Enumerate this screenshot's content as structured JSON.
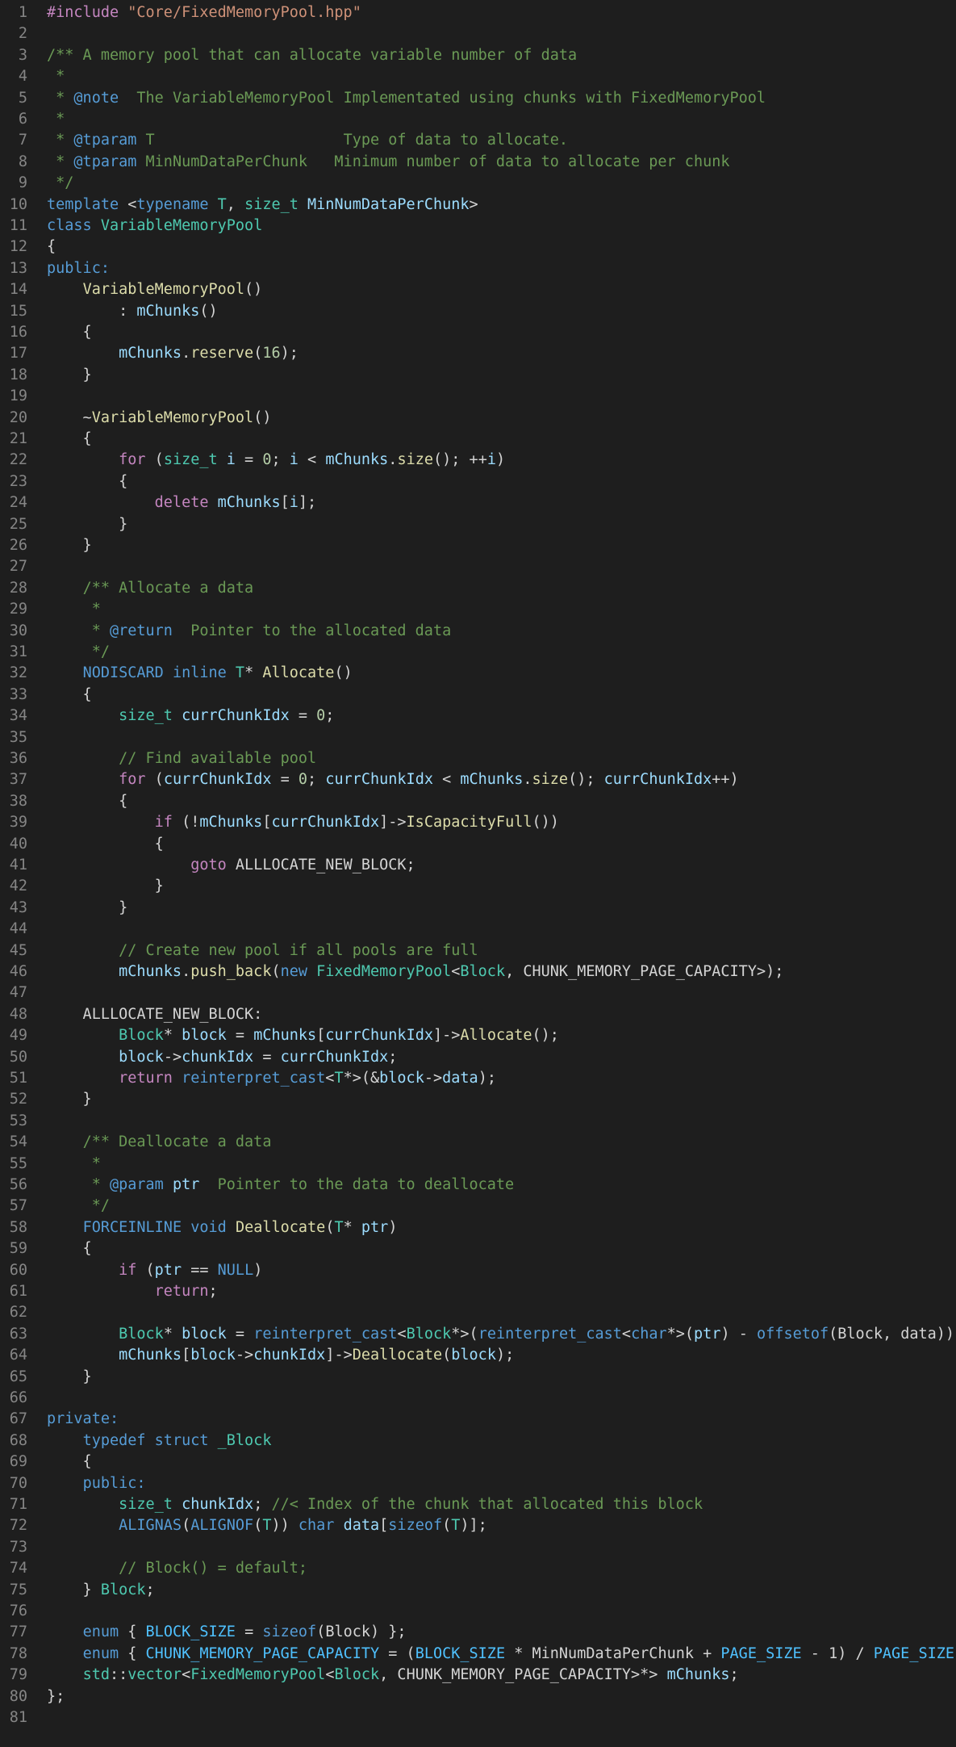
{
  "editor": {
    "language": "cpp",
    "colors": {
      "background": "#1e1e1e",
      "line_number": "#858585",
      "plain": "#d4d4d4",
      "comment": "#6a9955",
      "keyword": "#569cd6",
      "control": "#c586c0",
      "type": "#4ec9b0",
      "function": "#dcdcaa",
      "variable": "#9cdcfe",
      "number": "#b5cea8",
      "string": "#ce9178"
    },
    "lines": [
      [
        [
          "pp",
          "#include"
        ],
        [
          "pl",
          " "
        ],
        [
          "str",
          "\"Core/FixedMemoryPool.hpp\""
        ]
      ],
      [],
      [
        [
          "cm",
          "/** A memory pool that can allocate variable number of data"
        ]
      ],
      [
        [
          "cm",
          " *"
        ]
      ],
      [
        [
          "cm",
          " * "
        ],
        [
          "tag",
          "@note"
        ],
        [
          "cm",
          "  The VariableMemoryPool Implementated using chunks with FixedMemoryPool"
        ]
      ],
      [
        [
          "cm",
          " *"
        ]
      ],
      [
        [
          "cm",
          " * "
        ],
        [
          "tag",
          "@tparam"
        ],
        [
          "cm",
          " T                     Type of data to allocate."
        ]
      ],
      [
        [
          "cm",
          " * "
        ],
        [
          "tag",
          "@tparam"
        ],
        [
          "cm",
          " MinNumDataPerChunk   Minimum number of data to allocate per chunk"
        ]
      ],
      [
        [
          "cm",
          " */"
        ]
      ],
      [
        [
          "kw",
          "template"
        ],
        [
          "pl",
          " <"
        ],
        [
          "kw",
          "typename"
        ],
        [
          "pl",
          " "
        ],
        [
          "type",
          "T"
        ],
        [
          "pl",
          ", "
        ],
        [
          "type",
          "size_t"
        ],
        [
          "pl",
          " "
        ],
        [
          "var",
          "MinNumDataPerChunk"
        ],
        [
          "pl",
          ">"
        ]
      ],
      [
        [
          "kw",
          "class"
        ],
        [
          "pl",
          " "
        ],
        [
          "type",
          "VariableMemoryPool"
        ]
      ],
      [
        [
          "pl",
          "{"
        ]
      ],
      [
        [
          "kw",
          "public:"
        ]
      ],
      [
        [
          "pl",
          "    "
        ],
        [
          "fn",
          "VariableMemoryPool"
        ],
        [
          "pl",
          "()"
        ]
      ],
      [
        [
          "pl",
          "        : "
        ],
        [
          "var",
          "mChunks"
        ],
        [
          "pl",
          "()"
        ]
      ],
      [
        [
          "pl",
          "    {"
        ]
      ],
      [
        [
          "pl",
          "        "
        ],
        [
          "var",
          "mChunks"
        ],
        [
          "pl",
          "."
        ],
        [
          "fn",
          "reserve"
        ],
        [
          "pl",
          "("
        ],
        [
          "num",
          "16"
        ],
        [
          "pl",
          ");"
        ]
      ],
      [
        [
          "pl",
          "    }"
        ]
      ],
      [],
      [
        [
          "pl",
          "    ~"
        ],
        [
          "fn",
          "VariableMemoryPool"
        ],
        [
          "pl",
          "()"
        ]
      ],
      [
        [
          "pl",
          "    {"
        ]
      ],
      [
        [
          "pl",
          "        "
        ],
        [
          "ctl",
          "for"
        ],
        [
          "pl",
          " ("
        ],
        [
          "type",
          "size_t"
        ],
        [
          "pl",
          " "
        ],
        [
          "var",
          "i"
        ],
        [
          "pl",
          " = "
        ],
        [
          "num",
          "0"
        ],
        [
          "pl",
          "; "
        ],
        [
          "var",
          "i"
        ],
        [
          "pl",
          " < "
        ],
        [
          "var",
          "mChunks"
        ],
        [
          "pl",
          "."
        ],
        [
          "fn",
          "size"
        ],
        [
          "pl",
          "(); ++"
        ],
        [
          "var",
          "i"
        ],
        [
          "pl",
          ")"
        ]
      ],
      [
        [
          "pl",
          "        {"
        ]
      ],
      [
        [
          "pl",
          "            "
        ],
        [
          "ctl",
          "delete"
        ],
        [
          "pl",
          " "
        ],
        [
          "var",
          "mChunks"
        ],
        [
          "pl",
          "["
        ],
        [
          "var",
          "i"
        ],
        [
          "pl",
          "];"
        ]
      ],
      [
        [
          "pl",
          "        }"
        ]
      ],
      [
        [
          "pl",
          "    }"
        ]
      ],
      [],
      [
        [
          "pl",
          "    "
        ],
        [
          "cm",
          "/** Allocate a data"
        ]
      ],
      [
        [
          "cm",
          "     *"
        ]
      ],
      [
        [
          "cm",
          "     * "
        ],
        [
          "tag",
          "@return"
        ],
        [
          "cm",
          "  Pointer to the allocated data"
        ]
      ],
      [
        [
          "cm",
          "     */"
        ]
      ],
      [
        [
          "pl",
          "    "
        ],
        [
          "mac",
          "NODISCARD"
        ],
        [
          "pl",
          " "
        ],
        [
          "kw",
          "inline"
        ],
        [
          "pl",
          " "
        ],
        [
          "type",
          "T"
        ],
        [
          "pl",
          "* "
        ],
        [
          "fn",
          "Allocate"
        ],
        [
          "pl",
          "()"
        ]
      ],
      [
        [
          "pl",
          "    {"
        ]
      ],
      [
        [
          "pl",
          "        "
        ],
        [
          "type",
          "size_t"
        ],
        [
          "pl",
          " "
        ],
        [
          "var",
          "currChunkIdx"
        ],
        [
          "pl",
          " = "
        ],
        [
          "num",
          "0"
        ],
        [
          "pl",
          ";"
        ]
      ],
      [],
      [
        [
          "pl",
          "        "
        ],
        [
          "cm",
          "// Find available pool"
        ]
      ],
      [
        [
          "pl",
          "        "
        ],
        [
          "ctl",
          "for"
        ],
        [
          "pl",
          " ("
        ],
        [
          "var",
          "currChunkIdx"
        ],
        [
          "pl",
          " = "
        ],
        [
          "num",
          "0"
        ],
        [
          "pl",
          "; "
        ],
        [
          "var",
          "currChunkIdx"
        ],
        [
          "pl",
          " < "
        ],
        [
          "var",
          "mChunks"
        ],
        [
          "pl",
          "."
        ],
        [
          "fn",
          "size"
        ],
        [
          "pl",
          "(); "
        ],
        [
          "var",
          "currChunkIdx"
        ],
        [
          "pl",
          "++)"
        ]
      ],
      [
        [
          "pl",
          "        {"
        ]
      ],
      [
        [
          "pl",
          "            "
        ],
        [
          "ctl",
          "if"
        ],
        [
          "pl",
          " (!"
        ],
        [
          "var",
          "mChunks"
        ],
        [
          "pl",
          "["
        ],
        [
          "var",
          "currChunkIdx"
        ],
        [
          "pl",
          "]->"
        ],
        [
          "fn",
          "IsCapacityFull"
        ],
        [
          "pl",
          "())"
        ]
      ],
      [
        [
          "pl",
          "            {"
        ]
      ],
      [
        [
          "pl",
          "                "
        ],
        [
          "ctl",
          "goto"
        ],
        [
          "pl",
          " ALLLOCATE_NEW_BLOCK;"
        ]
      ],
      [
        [
          "pl",
          "            }"
        ]
      ],
      [
        [
          "pl",
          "        }"
        ]
      ],
      [],
      [
        [
          "pl",
          "        "
        ],
        [
          "cm",
          "// Create new pool if all pools are full"
        ]
      ],
      [
        [
          "pl",
          "        "
        ],
        [
          "var",
          "mChunks"
        ],
        [
          "pl",
          "."
        ],
        [
          "fn",
          "push_back"
        ],
        [
          "pl",
          "("
        ],
        [
          "kw",
          "new"
        ],
        [
          "pl",
          " "
        ],
        [
          "type",
          "FixedMemoryPool"
        ],
        [
          "pl",
          "<"
        ],
        [
          "type",
          "Block"
        ],
        [
          "pl",
          ", CHUNK_MEMORY_PAGE_CAPACITY>);"
        ]
      ],
      [],
      [
        [
          "pl",
          "    ALLLOCATE_NEW_BLOCK:"
        ]
      ],
      [
        [
          "pl",
          "        "
        ],
        [
          "type",
          "Block"
        ],
        [
          "pl",
          "* "
        ],
        [
          "var",
          "block"
        ],
        [
          "pl",
          " = "
        ],
        [
          "var",
          "mChunks"
        ],
        [
          "pl",
          "["
        ],
        [
          "var",
          "currChunkIdx"
        ],
        [
          "pl",
          "]->"
        ],
        [
          "fn",
          "Allocate"
        ],
        [
          "pl",
          "();"
        ]
      ],
      [
        [
          "pl",
          "        "
        ],
        [
          "var",
          "block"
        ],
        [
          "pl",
          "->"
        ],
        [
          "var",
          "chunkIdx"
        ],
        [
          "pl",
          " = "
        ],
        [
          "var",
          "currChunkIdx"
        ],
        [
          "pl",
          ";"
        ]
      ],
      [
        [
          "pl",
          "        "
        ],
        [
          "ctl",
          "return"
        ],
        [
          "pl",
          " "
        ],
        [
          "kw",
          "reinterpret_cast"
        ],
        [
          "pl",
          "<"
        ],
        [
          "type",
          "T"
        ],
        [
          "pl",
          "*>(&"
        ],
        [
          "var",
          "block"
        ],
        [
          "pl",
          "->"
        ],
        [
          "var",
          "data"
        ],
        [
          "pl",
          ");"
        ]
      ],
      [
        [
          "pl",
          "    }"
        ]
      ],
      [],
      [
        [
          "pl",
          "    "
        ],
        [
          "cm",
          "/** Deallocate a data"
        ]
      ],
      [
        [
          "cm",
          "     *"
        ]
      ],
      [
        [
          "cm",
          "     * "
        ],
        [
          "tag",
          "@param"
        ],
        [
          "cm",
          " "
        ],
        [
          "var",
          "ptr"
        ],
        [
          "cm",
          "  Pointer to the data to deallocate"
        ]
      ],
      [
        [
          "cm",
          "     */"
        ]
      ],
      [
        [
          "pl",
          "    "
        ],
        [
          "mac",
          "FORCEINLINE"
        ],
        [
          "pl",
          " "
        ],
        [
          "kw",
          "void"
        ],
        [
          "pl",
          " "
        ],
        [
          "fn",
          "Deallocate"
        ],
        [
          "pl",
          "("
        ],
        [
          "type",
          "T"
        ],
        [
          "pl",
          "* "
        ],
        [
          "var",
          "ptr"
        ],
        [
          "pl",
          ")"
        ]
      ],
      [
        [
          "pl",
          "    {"
        ]
      ],
      [
        [
          "pl",
          "        "
        ],
        [
          "ctl",
          "if"
        ],
        [
          "pl",
          " ("
        ],
        [
          "var",
          "ptr"
        ],
        [
          "pl",
          " == "
        ],
        [
          "mac",
          "NULL"
        ],
        [
          "pl",
          ")"
        ]
      ],
      [
        [
          "pl",
          "            "
        ],
        [
          "ctl",
          "return"
        ],
        [
          "pl",
          ";"
        ]
      ],
      [],
      [
        [
          "pl",
          "        "
        ],
        [
          "type",
          "Block"
        ],
        [
          "pl",
          "* "
        ],
        [
          "var",
          "block"
        ],
        [
          "pl",
          " = "
        ],
        [
          "kw",
          "reinterpret_cast"
        ],
        [
          "pl",
          "<"
        ],
        [
          "type",
          "Block"
        ],
        [
          "pl",
          "*>("
        ],
        [
          "kw",
          "reinterpret_cast"
        ],
        [
          "pl",
          "<"
        ],
        [
          "kw",
          "char"
        ],
        [
          "pl",
          "*>("
        ],
        [
          "var",
          "ptr"
        ],
        [
          "pl",
          ") - "
        ],
        [
          "kw",
          "offsetof"
        ],
        [
          "pl",
          "(Block, data));"
        ]
      ],
      [
        [
          "pl",
          "        "
        ],
        [
          "var",
          "mChunks"
        ],
        [
          "pl",
          "["
        ],
        [
          "var",
          "block"
        ],
        [
          "pl",
          "->"
        ],
        [
          "var",
          "chunkIdx"
        ],
        [
          "pl",
          "]->"
        ],
        [
          "fn",
          "Deallocate"
        ],
        [
          "pl",
          "("
        ],
        [
          "var",
          "block"
        ],
        [
          "pl",
          ");"
        ]
      ],
      [
        [
          "pl",
          "    }"
        ]
      ],
      [],
      [
        [
          "kw",
          "private:"
        ]
      ],
      [
        [
          "pl",
          "    "
        ],
        [
          "kw",
          "typedef"
        ],
        [
          "pl",
          " "
        ],
        [
          "kw",
          "struct"
        ],
        [
          "pl",
          " "
        ],
        [
          "type",
          "_Block"
        ]
      ],
      [
        [
          "pl",
          "    {"
        ]
      ],
      [
        [
          "pl",
          "    "
        ],
        [
          "kw",
          "public:"
        ]
      ],
      [
        [
          "pl",
          "        "
        ],
        [
          "type",
          "size_t"
        ],
        [
          "pl",
          " "
        ],
        [
          "var",
          "chunkIdx"
        ],
        [
          "pl",
          "; "
        ],
        [
          "cm",
          "//< Index of the chunk that allocated this block"
        ]
      ],
      [
        [
          "pl",
          "        "
        ],
        [
          "mac",
          "ALIGNAS"
        ],
        [
          "pl",
          "("
        ],
        [
          "mac",
          "ALIGNOF"
        ],
        [
          "pl",
          "("
        ],
        [
          "type",
          "T"
        ],
        [
          "pl",
          ")) "
        ],
        [
          "kw",
          "char"
        ],
        [
          "pl",
          " "
        ],
        [
          "var",
          "data"
        ],
        [
          "pl",
          "["
        ],
        [
          "kw",
          "sizeof"
        ],
        [
          "pl",
          "("
        ],
        [
          "type",
          "T"
        ],
        [
          "pl",
          ")];"
        ]
      ],
      [],
      [
        [
          "pl",
          "        "
        ],
        [
          "cm",
          "// Block() = default;"
        ]
      ],
      [
        [
          "pl",
          "    } "
        ],
        [
          "type",
          "Block"
        ],
        [
          "pl",
          ";"
        ]
      ],
      [],
      [
        [
          "pl",
          "    "
        ],
        [
          "kw",
          "enum"
        ],
        [
          "pl",
          " { "
        ],
        [
          "const",
          "BLOCK_SIZE"
        ],
        [
          "pl",
          " = "
        ],
        [
          "kw",
          "sizeof"
        ],
        [
          "pl",
          "(Block) };"
        ]
      ],
      [
        [
          "pl",
          "    "
        ],
        [
          "kw",
          "enum"
        ],
        [
          "pl",
          " { "
        ],
        [
          "const",
          "CHUNK_MEMORY_PAGE_CAPACITY"
        ],
        [
          "pl",
          " = ("
        ],
        [
          "const",
          "BLOCK_SIZE"
        ],
        [
          "pl",
          " * MinNumDataPerChunk + "
        ],
        [
          "const",
          "PAGE_SIZE"
        ],
        [
          "pl",
          " - 1) / "
        ],
        [
          "const",
          "PAGE_SIZE"
        ],
        [
          "pl",
          " };"
        ]
      ],
      [
        [
          "pl",
          "    "
        ],
        [
          "type",
          "std"
        ],
        [
          "pl",
          "::"
        ],
        [
          "type",
          "vector"
        ],
        [
          "pl",
          "<"
        ],
        [
          "type",
          "FixedMemoryPool"
        ],
        [
          "pl",
          "<"
        ],
        [
          "type",
          "Block"
        ],
        [
          "pl",
          ", CHUNK_MEMORY_PAGE_CAPACITY>*> "
        ],
        [
          "var",
          "mChunks"
        ],
        [
          "pl",
          ";"
        ]
      ],
      [
        [
          "pl",
          "};"
        ]
      ],
      []
    ]
  }
}
